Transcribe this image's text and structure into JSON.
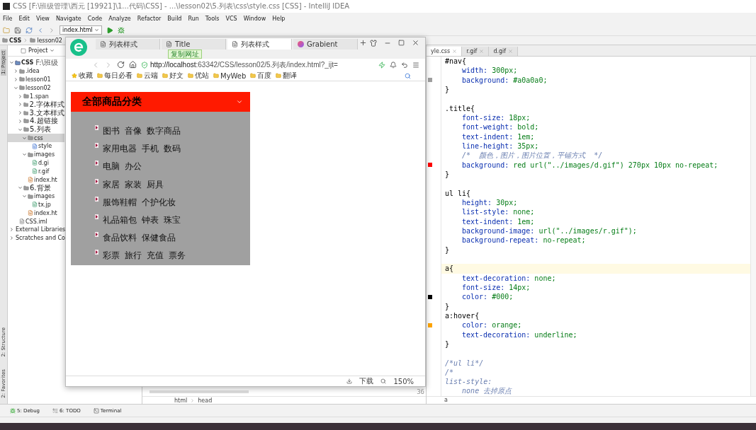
{
  "window": {
    "title": "CSS [F:\\班级管理\\西元 [19921]\\1...代码\\CSS] - ...\\lesson02\\5.列表\\css\\style.css [CSS] - IntelliJ IDEA"
  },
  "menu": [
    "File",
    "Edit",
    "View",
    "Navigate",
    "Code",
    "Analyze",
    "Refactor",
    "Build",
    "Run",
    "Tools",
    "VCS",
    "Window",
    "Help"
  ],
  "toolbar": {
    "run_config": "index.html"
  },
  "breadcrumb": [
    "CSS",
    "lesson02"
  ],
  "side_strip": {
    "top": "1: Project",
    "bottom": [
      "2: Structure",
      "2: Favorites"
    ]
  },
  "project": {
    "title": "Project",
    "tree": [
      {
        "label": "CSS",
        "path": "F:\\班级",
        "kind": "module",
        "expanded": true,
        "selected": false,
        "children": [
          {
            "label": ".idea",
            "kind": "folder",
            "expanded": false,
            "selected": false
          },
          {
            "label": "lesson01",
            "kind": "folder",
            "expanded": false,
            "selected": false
          },
          {
            "label": "lesson02",
            "kind": "folder",
            "expanded": true,
            "selected": false,
            "children": [
              {
                "label": "1.span",
                "kind": "folder",
                "expanded": false,
                "selected": false
              },
              {
                "label": "2.字体样式",
                "kind": "folder",
                "expanded": false,
                "selected": false
              },
              {
                "label": "3.文本样式",
                "kind": "folder",
                "expanded": false,
                "selected": false
              },
              {
                "label": "4.超链接",
                "kind": "folder",
                "expanded": false,
                "selected": false
              },
              {
                "label": "5.列表",
                "kind": "folder",
                "expanded": true,
                "selected": false,
                "children": [
                  {
                    "label": "css",
                    "kind": "folder",
                    "expanded": true,
                    "selected": true,
                    "children": [
                      {
                        "label": "style",
                        "kind": "css",
                        "selected": false
                      }
                    ]
                  },
                  {
                    "label": "images",
                    "kind": "folder",
                    "expanded": true,
                    "selected": false,
                    "children": [
                      {
                        "label": "d.gi",
                        "kind": "image",
                        "selected": false
                      },
                      {
                        "label": "r.gif",
                        "kind": "image",
                        "selected": false
                      }
                    ]
                  },
                  {
                    "label": "index.ht",
                    "kind": "html",
                    "selected": false
                  }
                ]
              },
              {
                "label": "6.背景",
                "kind": "folder",
                "expanded": true,
                "selected": false,
                "children": [
                  {
                    "label": "images",
                    "kind": "folder",
                    "expanded": true,
                    "selected": false,
                    "children": [
                      {
                        "label": "tx.jp",
                        "kind": "image",
                        "selected": false
                      }
                    ]
                  },
                  {
                    "label": "index.ht",
                    "kind": "html",
                    "selected": false
                  }
                ]
              }
            ]
          },
          {
            "label": "CSS.iml",
            "kind": "iml",
            "selected": false
          }
        ]
      },
      {
        "label": "External Libraries",
        "kind": "lib",
        "expanded": false,
        "selected": false
      },
      {
        "label": "Scratches and Co",
        "kind": "scratch",
        "expanded": false,
        "selected": false
      }
    ]
  },
  "editor_left": {
    "line_number": "36",
    "breadcrumb": [
      "html",
      "head"
    ]
  },
  "editor_right": {
    "tabs": [
      {
        "label": "yle.css",
        "selected": true
      },
      {
        "label": "r.gif",
        "selected": false
      },
      {
        "label": "d.gif",
        "selected": false
      }
    ],
    "lines": [
      {
        "kind": "selector",
        "text": "#nav{"
      },
      {
        "kind": "decl",
        "prop": "width:",
        "value": "300px;"
      },
      {
        "kind": "decl",
        "prop": "background:",
        "value": "#a0a0a0;",
        "color": "#a0a0a0"
      },
      {
        "kind": "close",
        "text": "}"
      },
      {
        "kind": "blank"
      },
      {
        "kind": "selector",
        "text": ".title{"
      },
      {
        "kind": "decl",
        "prop": "font-size:",
        "value": "18px;"
      },
      {
        "kind": "decl",
        "prop": "font-weight:",
        "value": "bold;"
      },
      {
        "kind": "decl",
        "prop": "text-indent:",
        "value": "1em;"
      },
      {
        "kind": "decl",
        "prop": "line-height:",
        "value": "35px;"
      },
      {
        "kind": "comment",
        "text": "    /*  颜色，图片，图片位置，平铺方式  */"
      },
      {
        "kind": "decl",
        "prop": "background:",
        "value": "red url(\"../images/d.gif\") 270px 10px no-repeat;",
        "color": "#ff0000"
      },
      {
        "kind": "close",
        "text": "}"
      },
      {
        "kind": "blank"
      },
      {
        "kind": "selector",
        "text": "ul li{"
      },
      {
        "kind": "decl",
        "prop": "height:",
        "value": "30px;"
      },
      {
        "kind": "decl",
        "prop": "list-style:",
        "value": "none;"
      },
      {
        "kind": "decl",
        "prop": "text-indent:",
        "value": "1em;"
      },
      {
        "kind": "decl",
        "prop": "background-image:",
        "value": "url(\"../images/r.gif\");"
      },
      {
        "kind": "decl",
        "prop": "background-repeat:",
        "value": "no-repeat;"
      },
      {
        "kind": "close",
        "text": "}"
      },
      {
        "kind": "blank"
      },
      {
        "kind": "selector",
        "text": "a{",
        "current": true
      },
      {
        "kind": "decl",
        "prop": "text-decoration:",
        "value": "none;"
      },
      {
        "kind": "decl",
        "prop": "font-size:",
        "value": "14px;"
      },
      {
        "kind": "decl",
        "prop": "color:",
        "value": "#000;",
        "color": "#000000"
      },
      {
        "kind": "close",
        "text": "}"
      },
      {
        "kind": "selector",
        "text": "a:hover{"
      },
      {
        "kind": "decl",
        "prop": "color:",
        "value": "orange;",
        "color": "#ffa500"
      },
      {
        "kind": "decl",
        "prop": "text-decoration:",
        "value": "underline;"
      },
      {
        "kind": "close",
        "text": "}"
      },
      {
        "kind": "blank"
      },
      {
        "kind": "comment",
        "text": "/*ul li*/"
      },
      {
        "kind": "comment",
        "text": "/*"
      },
      {
        "kind": "comment",
        "text": "list-style:"
      },
      {
        "kind": "comment",
        "text": "    none 去掉原点"
      }
    ],
    "breadcrumb": [
      "a"
    ]
  },
  "browser": {
    "tabs": [
      {
        "label": "列表样式",
        "kind": "page",
        "selected": false
      },
      {
        "label": "Title",
        "kind": "page",
        "selected": false
      },
      {
        "label": "列表样式",
        "kind": "page",
        "selected": true
      },
      {
        "label": "Grabient",
        "kind": "gradient",
        "selected": false
      }
    ],
    "tooltip": "复制网址",
    "url_host": "http://localhost",
    "url_rest": ":63342/CSS/lesson02/5.列表/index.html?_ijt=",
    "bookmarks": [
      "收藏",
      "每日必看",
      "云端",
      "好文",
      "优站",
      "MyWeb",
      "百度",
      "翻译"
    ],
    "page": {
      "title": "全部商品分类",
      "items": [
        [
          "图书",
          "音像",
          "数字商品"
        ],
        [
          "家用电器",
          "手机",
          "数码"
        ],
        [
          "电脑",
          "办公"
        ],
        [
          "家居",
          "家装",
          "厨具"
        ],
        [
          "服饰鞋帽",
          "个护化妆"
        ],
        [
          "礼品箱包",
          "钟表",
          "珠宝"
        ],
        [
          "食品饮料",
          "保健食品"
        ],
        [
          "彩票",
          "旅行",
          "充值",
          "票务"
        ]
      ]
    },
    "status": {
      "download": "下载",
      "zoom": "150%"
    }
  },
  "tool_windows": [
    "5: Debug",
    "6: TODO",
    "Terminal"
  ]
}
